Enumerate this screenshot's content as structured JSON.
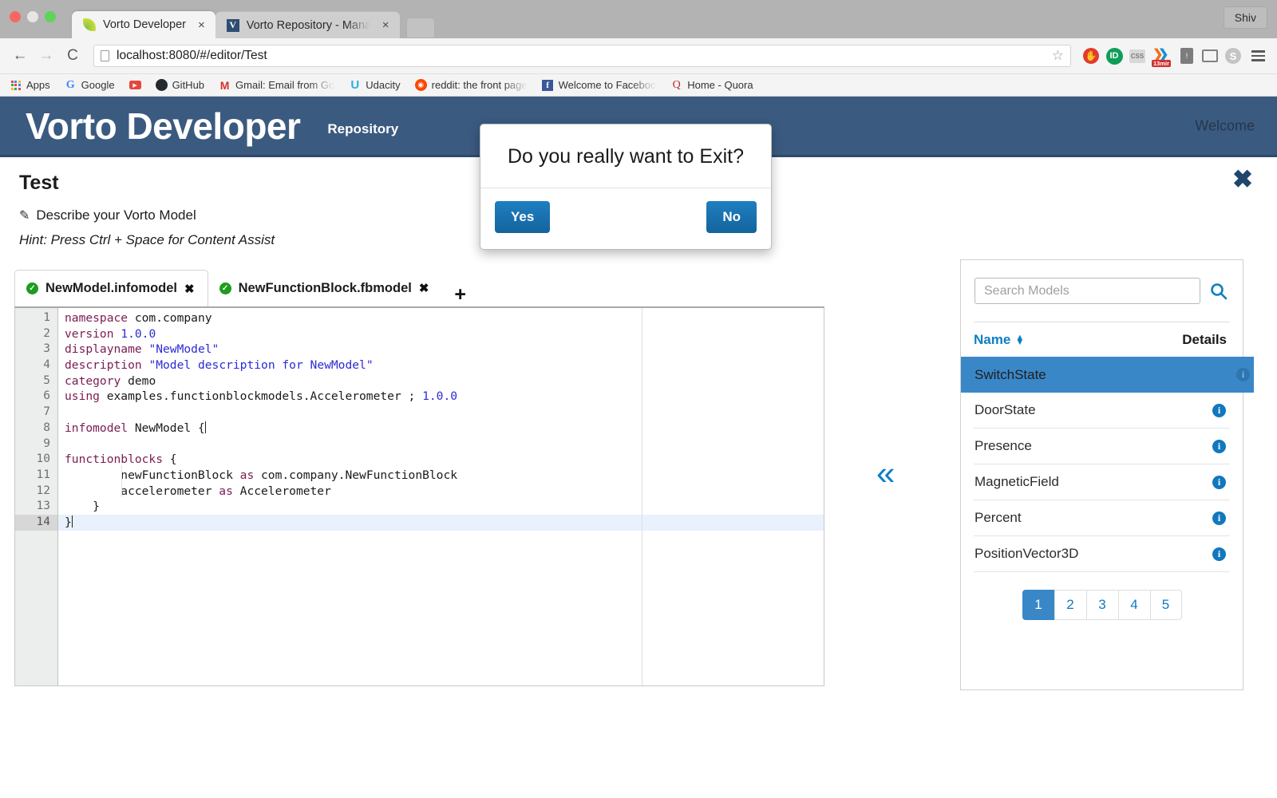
{
  "browser": {
    "tabs": [
      {
        "title": "Vorto Developer",
        "favicon": "leaf-icon",
        "active": true,
        "close": "×"
      },
      {
        "title": "Vorto Repository - Manage",
        "favicon": "letter-v-icon",
        "active": false,
        "close": "×"
      }
    ],
    "profile_label": "Shiv",
    "nav": {
      "back": "←",
      "forward": "→",
      "reload": "⟳"
    },
    "url": {
      "host": "localhost:8080",
      "path": "/#/editor/Test"
    },
    "star": "☆",
    "extensions": [
      "adblock-icon",
      "lastpass-icon",
      "css-icon",
      "13mir-icon",
      "battery-icon",
      "cast-icon",
      "skype-icon"
    ],
    "menu": "hamburger-menu-icon",
    "bookmarks": [
      {
        "label": "Apps",
        "icon": "apps-grid-icon"
      },
      {
        "label": "Google",
        "icon": "google-icon"
      },
      {
        "label": "",
        "icon": "youtube-icon"
      },
      {
        "label": "GitHub",
        "icon": "github-icon"
      },
      {
        "label": "Gmail: Email from Go",
        "icon": "gmail-icon"
      },
      {
        "label": "Udacity",
        "icon": "udacity-icon"
      },
      {
        "label": "reddit: the front page",
        "icon": "reddit-icon"
      },
      {
        "label": "Welcome to Faceboo",
        "icon": "facebook-icon"
      },
      {
        "label": "Home - Quora",
        "icon": "quora-icon"
      }
    ]
  },
  "app": {
    "brand": "Vorto Developer",
    "nav_repository": "Repository",
    "welcome": "Welcome",
    "page_title": "Test",
    "describe_label": "Describe your Vorto Model",
    "hint": "Hint: Press Ctrl + Space for Content Assist",
    "close_label": "✖"
  },
  "editor": {
    "tabs": [
      {
        "name": "NewModel.infomodel",
        "status": "valid",
        "active": true,
        "close": "✖"
      },
      {
        "name": "NewFunctionBlock.fbmodel",
        "status": "valid",
        "active": false,
        "close": "✖"
      }
    ],
    "add_tab": "+",
    "current_line": 14,
    "lines": [
      {
        "n": 1,
        "tokens": [
          {
            "t": "namespace",
            "c": "kw"
          },
          {
            "t": " com.company",
            "c": ""
          }
        ]
      },
      {
        "n": 2,
        "tokens": [
          {
            "t": "version",
            "c": "kw"
          },
          {
            "t": " ",
            "c": ""
          },
          {
            "t": "1.0.0",
            "c": "num"
          }
        ]
      },
      {
        "n": 3,
        "tokens": [
          {
            "t": "displayname",
            "c": "kw"
          },
          {
            "t": " ",
            "c": ""
          },
          {
            "t": "\"NewModel\"",
            "c": "str"
          }
        ]
      },
      {
        "n": 4,
        "tokens": [
          {
            "t": "description",
            "c": "kw"
          },
          {
            "t": " ",
            "c": ""
          },
          {
            "t": "\"Model description for NewModel\"",
            "c": "str"
          }
        ]
      },
      {
        "n": 5,
        "tokens": [
          {
            "t": "category",
            "c": "kw"
          },
          {
            "t": " demo",
            "c": ""
          }
        ]
      },
      {
        "n": 6,
        "tokens": [
          {
            "t": "using",
            "c": "kw"
          },
          {
            "t": " examples.functionblockmodels.Accelerometer ; ",
            "c": ""
          },
          {
            "t": "1.0.0",
            "c": "num"
          }
        ]
      },
      {
        "n": 7,
        "tokens": []
      },
      {
        "n": 8,
        "tokens": [
          {
            "t": "infomodel",
            "c": "kw"
          },
          {
            "t": " NewModel {",
            "c": ""
          }
        ]
      },
      {
        "n": 9,
        "tokens": []
      },
      {
        "n": 10,
        "tokens": [
          {
            "t": "functionblocks",
            "c": "kw"
          },
          {
            "t": " {",
            "c": ""
          }
        ]
      },
      {
        "n": 11,
        "tokens": [
          {
            "t": "        newFunctionBlock ",
            "c": ""
          },
          {
            "t": "as",
            "c": "kw"
          },
          {
            "t": " com.company.NewFunctionBlock",
            "c": ""
          }
        ]
      },
      {
        "n": 12,
        "tokens": [
          {
            "t": "        accelerometer ",
            "c": ""
          },
          {
            "t": "as",
            "c": "kw"
          },
          {
            "t": " Accelerometer",
            "c": ""
          }
        ]
      },
      {
        "n": 13,
        "tokens": [
          {
            "t": "    }",
            "c": ""
          }
        ]
      },
      {
        "n": 14,
        "tokens": [
          {
            "t": "}",
            "c": ""
          }
        ]
      }
    ]
  },
  "collapse_button": {
    "glyph": "«",
    "name": "collapse-panel-icon"
  },
  "repository_panel": {
    "search_placeholder": "Search Models",
    "search_value": "",
    "search_icon": "search-icon",
    "columns": [
      "Name",
      "Details"
    ],
    "sort_glyph_up": "▲",
    "sort_glyph_down": "▼",
    "rows": [
      {
        "name": "SwitchState",
        "details_icon": "info-icon",
        "selected": true
      },
      {
        "name": "DoorState",
        "details_icon": "info-icon",
        "selected": false
      },
      {
        "name": "Presence",
        "details_icon": "info-icon",
        "selected": false
      },
      {
        "name": "MagneticField",
        "details_icon": "info-icon",
        "selected": false
      },
      {
        "name": "Percent",
        "details_icon": "info-icon",
        "selected": false
      },
      {
        "name": "PositionVector3D",
        "details_icon": "info-icon",
        "selected": false
      }
    ],
    "pagination": {
      "pages": [
        "1",
        "2",
        "3",
        "4",
        "5"
      ],
      "active": "1"
    }
  },
  "dialog": {
    "message": "Do you really want to Exit?",
    "yes_label": "Yes",
    "no_label": "No"
  },
  "colors": {
    "header_blue": "#3b5a80",
    "accent_blue": "#1278be",
    "selected_row": "#3a87c8",
    "button_blue": "#1f7fc0",
    "keyword": "#7b1b52",
    "string": "#2b2bd6",
    "valid_green": "#1d9c1d"
  }
}
